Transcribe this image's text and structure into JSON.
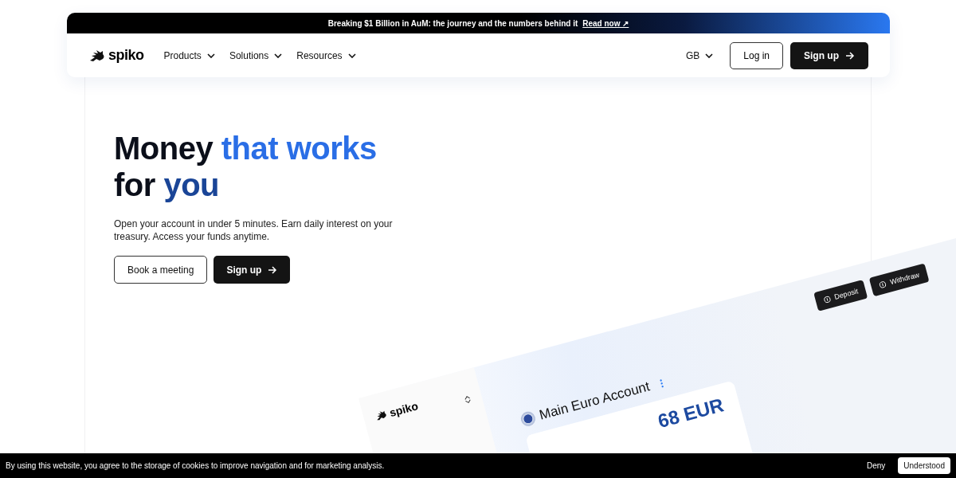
{
  "banner": {
    "text": "Breaking $1 Billion in AuM: the journey and the numbers behind it",
    "link": "Read now ↗"
  },
  "nav": {
    "logo": "spiko",
    "menus": [
      {
        "label": "Products"
      },
      {
        "label": "Solutions"
      },
      {
        "label": "Resources"
      }
    ],
    "language": "GB",
    "login": "Log in",
    "signup": "Sign up"
  },
  "hero": {
    "headline": [
      {
        "text": "Money ",
        "color": "#0b0f1a"
      },
      {
        "text": "that works",
        "color": "#2a6ee6"
      },
      {
        "text": "for ",
        "color": "#0b0f1a"
      },
      {
        "text": "you",
        "color": "#1a4597"
      }
    ],
    "subtitle": "Open your account in under 5 minutes. Earn daily interest on your treasury. Access your funds anytime.",
    "buttons": [
      {
        "label": "Book a meeting",
        "kind": "outline"
      },
      {
        "label": "Sign up",
        "kind": "solid"
      }
    ]
  },
  "app_preview": {
    "logo": "spiko",
    "account_title": "Main Euro Account",
    "balance": "68 EUR",
    "actions": [
      {
        "label": "Deposit"
      },
      {
        "label": "Withdraw"
      }
    ]
  },
  "cookie_bar": {
    "text": "By using this website, you agree to the storage of cookies to improve navigation and for marketing analysis.",
    "deny": "Deny",
    "accept": "Understood"
  }
}
